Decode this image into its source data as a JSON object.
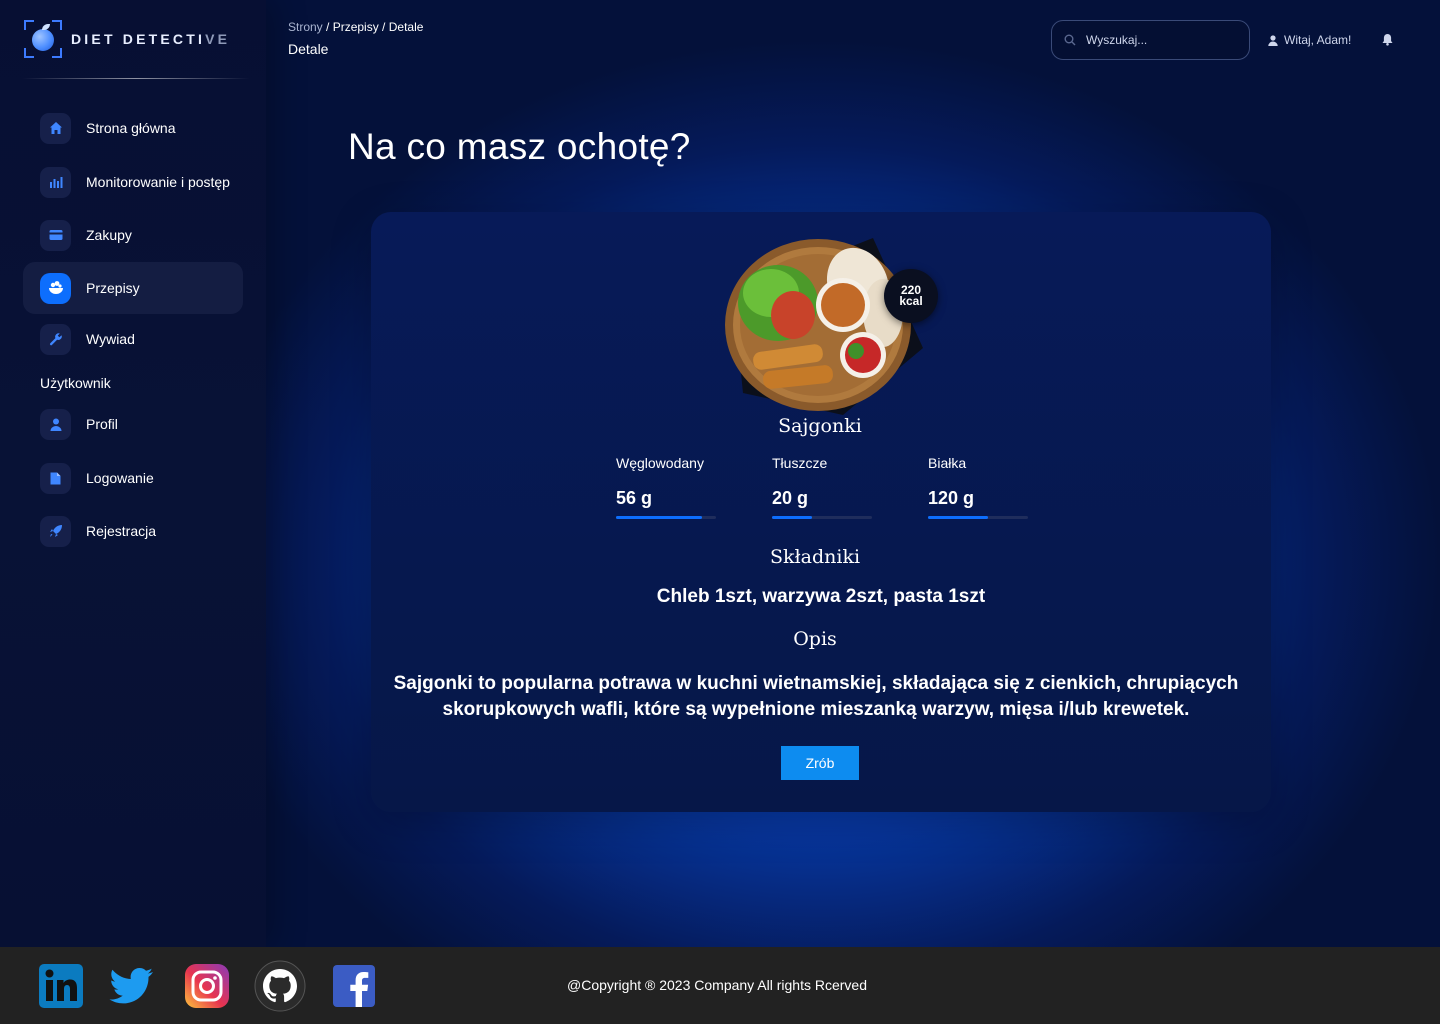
{
  "brand": {
    "name_main": "DIET DETECTI",
    "name_fade": "VE"
  },
  "sidebar": {
    "items": [
      {
        "label": "Strona główna",
        "icon": "home-icon"
      },
      {
        "label": "Monitorowanie i postęp",
        "icon": "bar-chart-icon"
      },
      {
        "label": "Zakupy",
        "icon": "credit-card-icon"
      },
      {
        "label": "Przepisy",
        "icon": "recipes-icon",
        "active": true
      },
      {
        "label": "Wywiad",
        "icon": "wrench-icon"
      }
    ],
    "section_label": "Użytkownik",
    "user_items": [
      {
        "label": "Profil",
        "icon": "user-icon"
      },
      {
        "label": "Logowanie",
        "icon": "document-icon"
      },
      {
        "label": "Rejestracja",
        "icon": "rocket-icon"
      }
    ]
  },
  "header": {
    "breadcrumb": {
      "root": "Strony",
      "middle": "/ Przepisy /",
      "current": "Detale"
    },
    "page_title": "Detale",
    "search_placeholder": "Wyszukaj...",
    "greeting": "Witaj, Adam!"
  },
  "main": {
    "heading": "Na co masz ochotę?",
    "recipe": {
      "name": "Sajgonki",
      "kcal_value": "220",
      "kcal_unit": "kcal",
      "macros": [
        {
          "label": "Węglowodany",
          "value": "56 g",
          "progress": 0.86
        },
        {
          "label": "Tłuszcze",
          "value": "20 g",
          "progress": 0.4
        },
        {
          "label": "Białka",
          "value": "120 g",
          "progress": 0.6
        }
      ],
      "ingredients_title": "Składniki",
      "ingredients": "Chleb 1szt, warzywa 2szt, pasta 1szt",
      "description_title": "Opis",
      "description": "Sajgonki to popularna potrawa w kuchni wietnamskiej, składająca się z cienkich, chrupiących skorupkowych wafli, które są wypełnione mieszanką warzyw, mięsa i/lub krewetek.",
      "action_label": "Zrób"
    }
  },
  "footer": {
    "social": [
      "linkedin-icon",
      "twitter-icon",
      "instagram-icon",
      "github-icon",
      "facebook-icon"
    ],
    "copyright": "@Copyright ® 2023 Company All rights Rcerved"
  },
  "colors": {
    "accent": "#0d6efd",
    "button": "#0d8cf0",
    "footer": "#222222",
    "card": "#061748"
  }
}
